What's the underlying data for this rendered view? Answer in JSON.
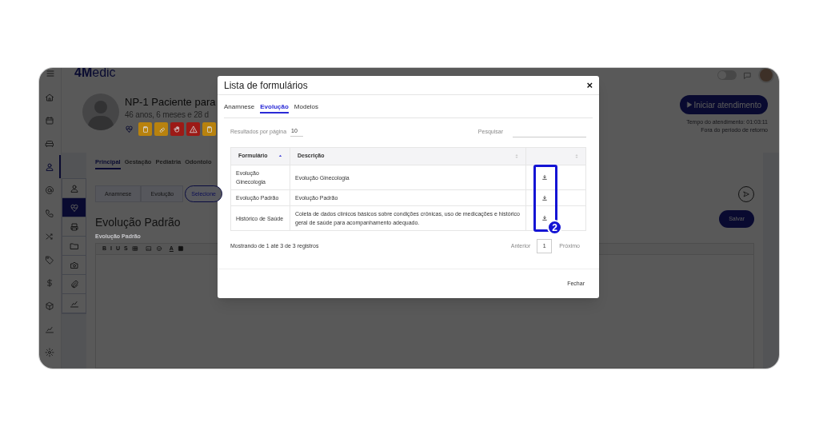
{
  "app": {
    "logo": "**4M**edic",
    "nav_rail": [
      {
        "selected": false
      },
      {
        "selected": false
      },
      {
        "selected": false
      },
      {
        "selected": true
      },
      {
        "selected": false
      },
      {
        "selected": false
      },
      {
        "selected": false
      },
      {
        "selected": false
      },
      {
        "selected": false
      },
      {
        "selected": false
      },
      {
        "selected": false
      },
      {
        "selected": false
      }
    ],
    "patient": {
      "name": "NP-1 Paciente para",
      "age": "46 anos, 6 meses e 28 d",
      "alerts": [
        {
          "color": "#b8820e"
        },
        {
          "color": "#b8820e"
        },
        {
          "color": "#9c1a16"
        },
        {
          "color": "#9c1a16"
        },
        {
          "color": "#b8820e"
        }
      ]
    },
    "toggle": {
      "on": false
    },
    "start_button": "Iniciar atendimento",
    "timer": "Tempo do atendimento: 01:03:11",
    "return_status": "Fora do período de retorno",
    "side_rail": [
      {
        "selected": false
      },
      {
        "selected": true
      },
      {
        "selected": false
      },
      {
        "selected": false
      },
      {
        "selected": false
      },
      {
        "selected": false
      },
      {
        "selected": false
      }
    ],
    "tabs": [
      {
        "label": "Principal",
        "selected": true
      },
      {
        "label": "Gestação",
        "selected": false
      },
      {
        "label": "Pediatria",
        "selected": false
      },
      {
        "label": "Odontolo",
        "selected": false
      }
    ],
    "sub_tabs": [
      {
        "label": "Anamnese",
        "selected": false
      },
      {
        "label": "Evolução",
        "selected": false
      }
    ],
    "select_button": "Selecione",
    "heading": "Evolução Padrão",
    "field_label": "Evolução Padrão",
    "toolbar": [
      {
        "kind": "text",
        "label": "B"
      },
      {
        "kind": "text",
        "label": "I"
      },
      {
        "kind": "text",
        "label": "U"
      },
      {
        "kind": "text",
        "label": "S"
      },
      {
        "kind": "table"
      },
      {
        "kind": "image"
      },
      {
        "kind": "emoji"
      },
      {
        "kind": "color",
        "label": "A"
      },
      {
        "kind": "highlight"
      }
    ],
    "save_button": "Salvar"
  },
  "modal": {
    "title": "Lista de formulários",
    "close": "×",
    "tabs": [
      {
        "label": "Anamnese",
        "selected": false
      },
      {
        "label": "Evolução",
        "selected": true
      },
      {
        "label": "Modelos",
        "selected": false
      }
    ],
    "page_size_label": "Resultados por página",
    "page_size": "10",
    "search_label": "Pesquisar",
    "columns": [
      {
        "label": "Formulário",
        "sorted": true
      },
      {
        "label": "Descrição",
        "sorted": false
      },
      {
        "sorted": false
      }
    ],
    "rows": [
      {
        "form": "Evolução Ginecologia",
        "description": "Evolução Ginecologia"
      },
      {
        "form": "Evolução Padrão",
        "description": "Evolução Padrão"
      },
      {
        "form": "Histórico de Saúde",
        "description": "Coleta de dados clínicos básicos sobre condições crônicas, uso de medicações e histórico geral de saúde para acompanhamento adequado."
      }
    ],
    "summary": "Mostrando de 1 até 3 de 3 registros",
    "prev": "Anterior",
    "page": "1",
    "next": "Próximo",
    "close_button": "Fechar"
  },
  "annotation": {
    "label": "2"
  }
}
